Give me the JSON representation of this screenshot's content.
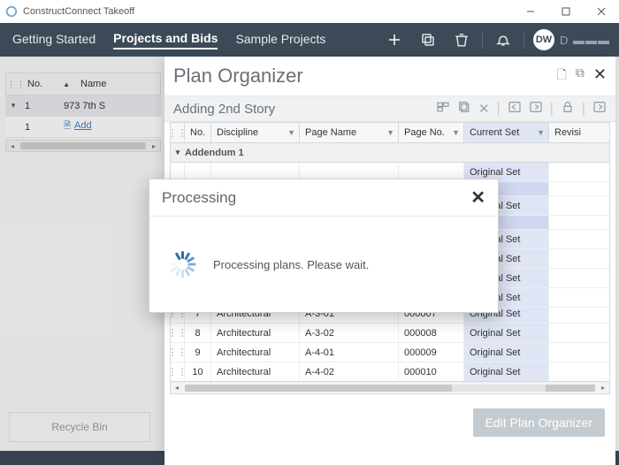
{
  "window": {
    "title": "ConstructConnect Takeoff"
  },
  "nav": {
    "items": [
      "Getting Started",
      "Projects and Bids",
      "Sample Projects"
    ],
    "active_index": 1,
    "avatar": "DW",
    "user_prefix": "D"
  },
  "left_grid": {
    "col_no": "No.",
    "col_name": "Name",
    "row1_no": "1",
    "row1_name": "973 7th S",
    "row2_no": "1",
    "row2_link": "Add"
  },
  "recycle_label": "Recycle Bin",
  "plan": {
    "title": "Plan Organizer",
    "subtitle": "Adding 2nd Story",
    "columns": {
      "no": "No.",
      "discipline": "Discipline",
      "page_name": "Page Name",
      "page_no": "Page No.",
      "current_set": "Current Set",
      "revision": "Revisi"
    },
    "group_label": "Addendum 1",
    "current_set_value": "Original Set",
    "rows": [
      {
        "no": "7",
        "discipline": "Architectural",
        "page_name": "A-3-01",
        "page_no": "000007",
        "current_set": "Original Set"
      },
      {
        "no": "8",
        "discipline": "Architectural",
        "page_name": "A-3-02",
        "page_no": "000008",
        "current_set": "Original Set"
      },
      {
        "no": "9",
        "discipline": "Architectural",
        "page_name": "A-4-01",
        "page_no": "000009",
        "current_set": "Original Set"
      },
      {
        "no": "10",
        "discipline": "Architectural",
        "page_name": "A-4-02",
        "page_no": "000010",
        "current_set": "Original Set"
      }
    ],
    "edit_button": "Edit Plan Organizer"
  },
  "modal": {
    "title": "Processing",
    "message": "Processing plans. Please wait."
  }
}
